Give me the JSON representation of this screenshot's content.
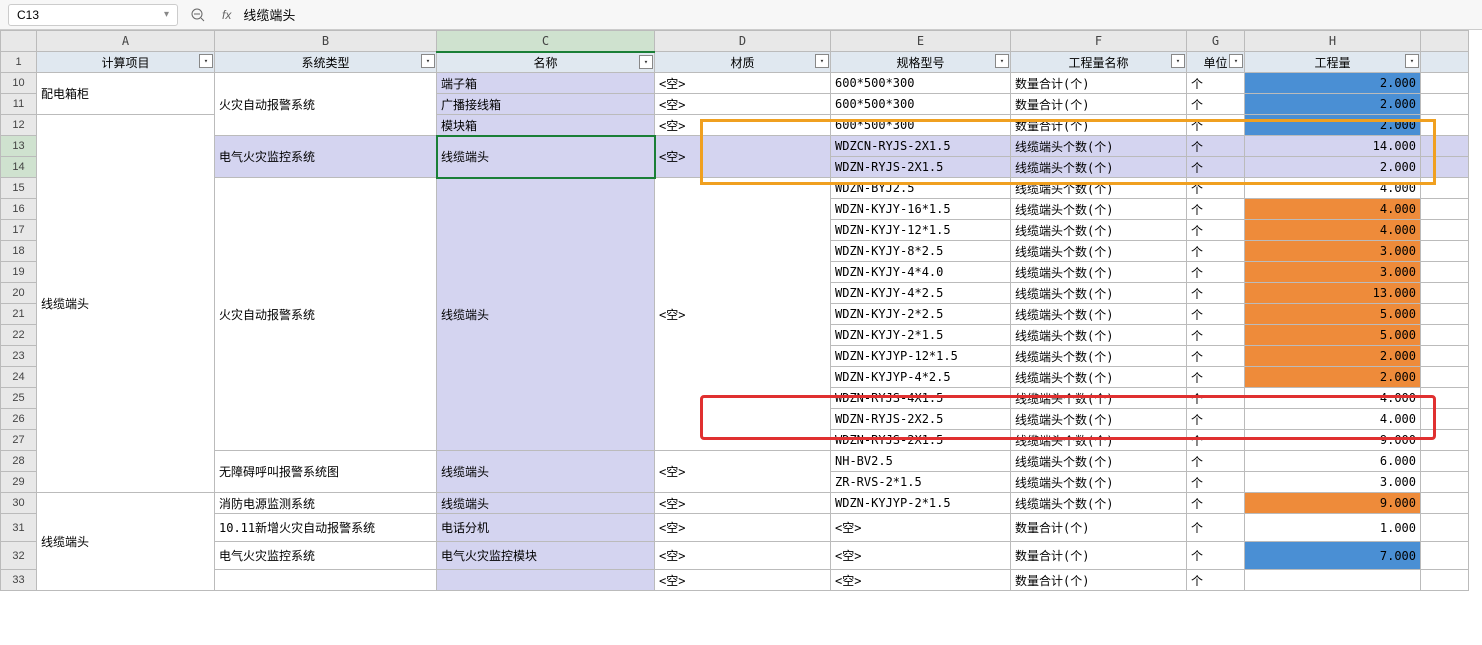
{
  "toolbar": {
    "cell_ref": "C13",
    "formula_value": "线缆端头",
    "fx": "fx"
  },
  "columns": [
    "",
    "A",
    "B",
    "C",
    "D",
    "E",
    "F",
    "G",
    "H",
    ""
  ],
  "headers": {
    "row_num": "1",
    "A": "计算项目",
    "B": "系统类型",
    "C": "名称",
    "D": "材质",
    "E": "规格型号",
    "F": "工程量名称",
    "G": "单位",
    "H": "工程量"
  },
  "rows": [
    {
      "n": "10",
      "A": "配电箱柜",
      "B": "",
      "C": "端子箱",
      "D": "<空>",
      "E": "600*500*300",
      "F": "数量合计(个)",
      "G": "个",
      "H": "2.000",
      "hclass": "blue-q",
      "Arowspan": 2,
      "Browspan": 3
    },
    {
      "n": "11",
      "B": "火灾自动报警系统",
      "C": "广播接线箱",
      "D": "<空>",
      "E": "600*500*300",
      "F": "数量合计(个)",
      "G": "个",
      "H": "2.000",
      "hclass": "blue-q",
      "skipA": true,
      "skipB": true
    },
    {
      "n": "12",
      "A": "",
      "C": "模块箱",
      "D": "<空>",
      "E": "600*500*300",
      "F": "数量合计(个)",
      "G": "个",
      "H": "2.000",
      "hclass": "blue-q",
      "skipB": true,
      "Arowspan": 18
    },
    {
      "n": "13",
      "B": "电气火灾监控系统",
      "C": "线缆端头",
      "D": "<空>",
      "E": "WDZCN-RYJS-2X1.5",
      "F": "线缆端头个数(个)",
      "G": "个",
      "H": "14.000",
      "hclass": "qty",
      "sel": true,
      "skipA": true,
      "Browspan": 2,
      "Crowspan": 2,
      "Drowspan": 2
    },
    {
      "n": "14",
      "E": "WDZN-RYJS-2X1.5",
      "F": "线缆端头个数(个)",
      "G": "个",
      "H": "2.000",
      "hclass": "qty",
      "sel": true,
      "skipA": true,
      "skipB": true,
      "skipC": true,
      "skipD": true
    },
    {
      "n": "15",
      "B": "",
      "C": "",
      "D": "",
      "E": "WDZN-BYJ2.5",
      "F": "线缆端头个数(个)",
      "G": "个",
      "H": "4.000",
      "hclass": "qty",
      "skipA": true,
      "Browspan": 13,
      "Crowspan": 13,
      "Drowspan": 13
    },
    {
      "n": "16",
      "E": "WDZN-KYJY-16*1.5",
      "F": "线缆端头个数(个)",
      "G": "个",
      "H": "4.000",
      "hclass": "orange-q",
      "skipA": true,
      "skipB": true,
      "skipC": true,
      "skipD": true
    },
    {
      "n": "17",
      "E": "WDZN-KYJY-12*1.5",
      "F": "线缆端头个数(个)",
      "G": "个",
      "H": "4.000",
      "hclass": "orange-q",
      "skipA": true,
      "skipB": true,
      "skipC": true,
      "skipD": true
    },
    {
      "n": "18",
      "E": "WDZN-KYJY-8*2.5",
      "F": "线缆端头个数(个)",
      "G": "个",
      "H": "3.000",
      "hclass": "orange-q",
      "skipA": true,
      "skipB": true,
      "skipC": true,
      "skipD": true
    },
    {
      "n": "19",
      "E": "WDZN-KYJY-4*4.0",
      "F": "线缆端头个数(个)",
      "G": "个",
      "H": "3.000",
      "hclass": "orange-q",
      "skipA": true,
      "skipB": true,
      "skipC": true,
      "skipD": true
    },
    {
      "n": "20",
      "E": "WDZN-KYJY-4*2.5",
      "F": "线缆端头个数(个)",
      "G": "个",
      "H": "13.000",
      "hclass": "orange-q",
      "skipA": true,
      "skipB": true,
      "skipC": true,
      "skipD": true
    },
    {
      "n": "21",
      "B": "火灾自动报警系统",
      "C": "线缆端头",
      "D": "<空>",
      "E": "WDZN-KYJY-2*2.5",
      "F": "线缆端头个数(个)",
      "G": "个",
      "H": "5.000",
      "hclass": "orange-q",
      "skipA": true,
      "skipB": true,
      "skipC": true,
      "skipD": true,
      "midB": true,
      "midC": true,
      "midD": true
    },
    {
      "n": "22",
      "E": "WDZN-KYJY-2*1.5",
      "F": "线缆端头个数(个)",
      "G": "个",
      "H": "5.000",
      "hclass": "orange-q",
      "skipA": true,
      "skipB": true,
      "skipC": true,
      "skipD": true
    },
    {
      "n": "23",
      "E": "WDZN-KYJYP-12*1.5",
      "F": "线缆端头个数(个)",
      "G": "个",
      "H": "2.000",
      "hclass": "orange-q",
      "skipA": true,
      "skipB": true,
      "skipC": true,
      "skipD": true
    },
    {
      "n": "24",
      "E": "WDZN-KYJYP-4*2.5",
      "F": "线缆端头个数(个)",
      "G": "个",
      "H": "2.000",
      "hclass": "orange-q",
      "skipA": true,
      "skipB": true,
      "skipC": true,
      "skipD": true
    },
    {
      "n": "25",
      "E": "WDZN-RYJS-4X1.5",
      "F": "线缆端头个数(个)",
      "G": "个",
      "H": "4.000",
      "hclass": "qty",
      "skipA": true,
      "skipB": true,
      "skipC": true,
      "skipD": true
    },
    {
      "n": "26",
      "E": "WDZN-RYJS-2X2.5",
      "F": "线缆端头个数(个)",
      "G": "个",
      "H": "4.000",
      "hclass": "qty",
      "skipA": true,
      "skipB": true,
      "skipC": true,
      "skipD": true
    },
    {
      "n": "27",
      "E": "WDZN-RYJS-2X1.5",
      "F": "线缆端头个数(个)",
      "G": "个",
      "H": "9.000",
      "hclass": "qty",
      "skipA": true,
      "skipB": true,
      "skipC": true,
      "skipD": true
    },
    {
      "n": "28",
      "B": "无障碍呼叫报警系统图",
      "C": "线缆端头",
      "D": "<空>",
      "E": "NH-BV2.5",
      "F": "线缆端头个数(个)",
      "G": "个",
      "H": "6.000",
      "hclass": "qty",
      "skipA": true,
      "Browspan": 2,
      "Crowspan": 2,
      "Drowspan": 2
    },
    {
      "n": "29",
      "E": "ZR-RVS-2*1.5",
      "F": "线缆端头个数(个)",
      "G": "个",
      "H": "3.000",
      "hclass": "qty",
      "skipA": true,
      "skipB": true,
      "skipC": true,
      "skipD": true
    },
    {
      "n": "30",
      "A": "线缆端头",
      "B": "消防电源监测系统",
      "C": "线缆端头",
      "D": "<空>",
      "E": "WDZN-KYJYP-2*1.5",
      "F": "线缆端头个数(个)",
      "G": "个",
      "H": "9.000",
      "hclass": "orange-q",
      "midA": true,
      "Arowspan": 4
    },
    {
      "n": "31",
      "B": "10.11新增火灾自动报警系统",
      "C": "电话分机",
      "D": "<空>",
      "E": "<空>",
      "F": "数量合计(个)",
      "G": "个",
      "H": "1.000",
      "hclass": "qty",
      "skipA": true,
      "tall": true
    },
    {
      "n": "32",
      "B": "电气火灾监控系统",
      "C": "电气火灾监控模块",
      "D": "<空>",
      "E": "<空>",
      "F": "数量合计(个)",
      "G": "个",
      "H": "7.000",
      "hclass": "blue-q",
      "skipA": true,
      "tall": true
    },
    {
      "n": "33",
      "B": "",
      "C": "",
      "D": "<空>",
      "E": "<空>",
      "F": "数量合计(个)",
      "G": "个",
      "H": "",
      "hclass": "qty",
      "skipA": true,
      "partial": true
    }
  ]
}
